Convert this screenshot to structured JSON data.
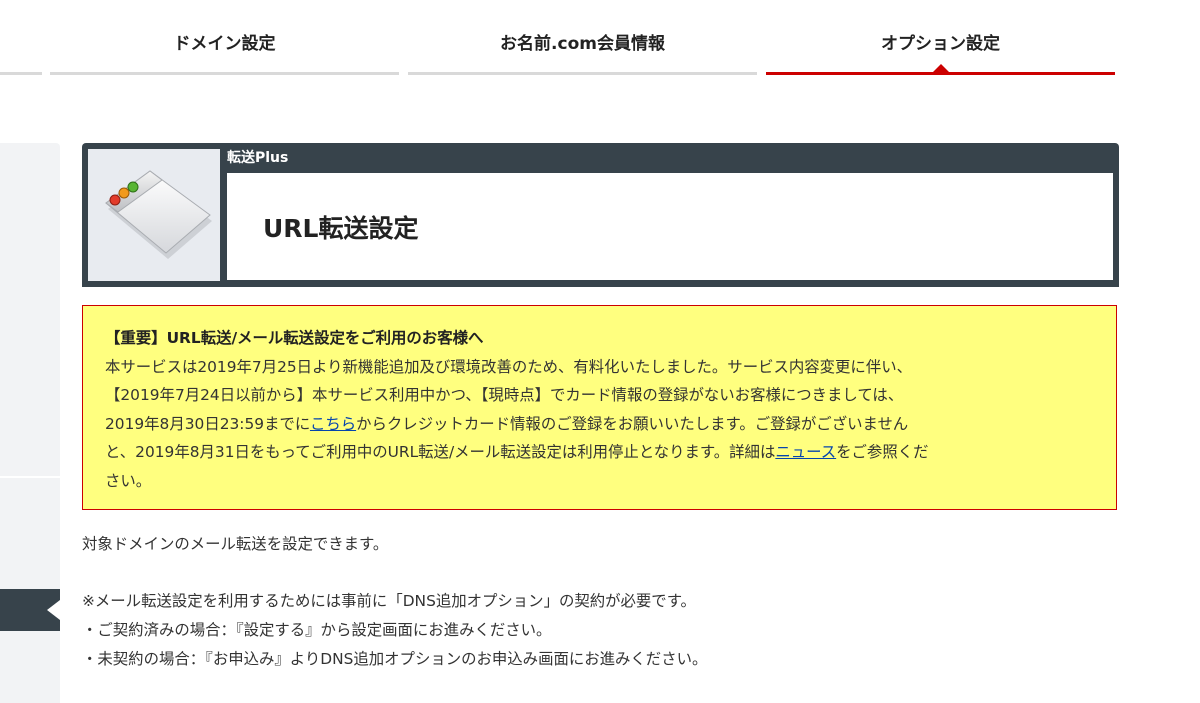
{
  "nav": {
    "tabs": [
      {
        "label": "ドメイン設定",
        "active": false
      },
      {
        "label": "お名前.com会員情報",
        "active": false
      },
      {
        "label": "オプション設定",
        "active": true
      }
    ]
  },
  "service": {
    "subtitle": "転送Plus",
    "title": "URL転送設定",
    "icon": "browser-window-icon"
  },
  "notice": {
    "title": "【重要】URL転送/メール転送設定をご利用のお客様へ",
    "line1": "本サービスは2019年7月25日より新機能追加及び環境改善のため、有料化いたしました。サービス内容変更に伴い、",
    "line2": "【2019年7月24日以前から】本サービス利用中かつ、【現時点】でカード情報の登録がないお客様につきましては、",
    "line3_before": "2019年8月30日23:59までに",
    "line3_link": "こちら",
    "line3_after": "からクレジットカード情報のご登録をお願いいたします。ご登録がございません",
    "line4_before": "と、2019年8月31日をもってご利用中のURL転送/メール転送設定は利用停止となります。詳細は",
    "line4_link": "ニュース",
    "line4_after": "をご参照くだ",
    "line5": "さい。"
  },
  "description": "対象ドメインのメール転送を設定できます。",
  "requirements": {
    "note": "※メール転送設定を利用するためには事前に「DNS追加オプション」の契約が必要です。",
    "contracted": "・ご契約済みの場合：『設定する』から設定画面にお進みください。",
    "not_contracted": "・未契約の場合：『お申込み』よりDNS追加オプションのお申込み画面にお進みください。"
  },
  "colors": {
    "accent": "#cc0000",
    "header_bg": "#37434b",
    "notice_bg": "#ffff7f",
    "link": "#0645ad"
  }
}
